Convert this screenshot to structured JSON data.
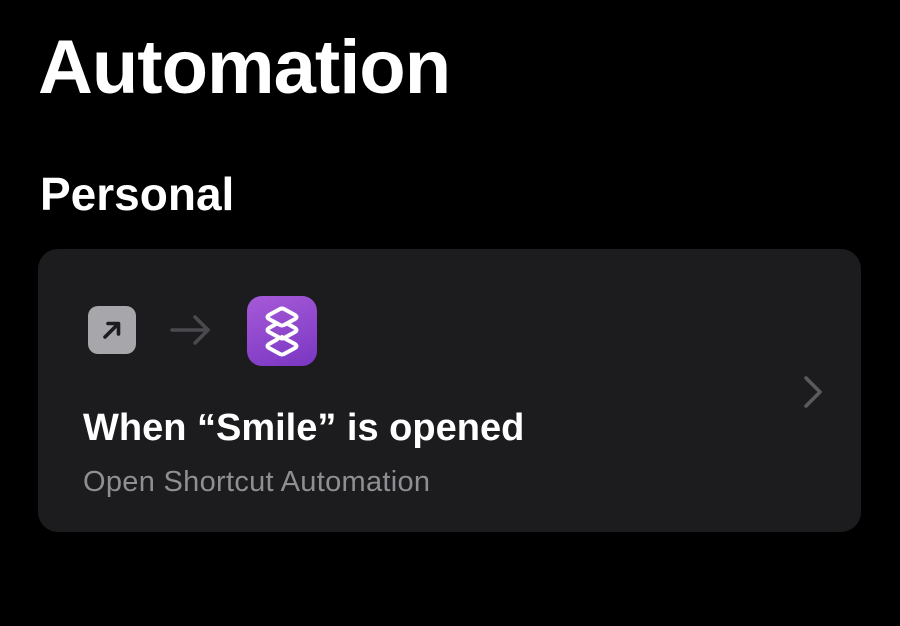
{
  "header": {
    "title": "Automation"
  },
  "sections": [
    {
      "title": "Personal",
      "automations": [
        {
          "title": "When “Smile” is opened",
          "subtitle": "Open Shortcut Automation",
          "trigger_icon": "app-opened-icon",
          "action_icon": "shortcuts-app-icon",
          "accessory_icon": "chevron-right-icon"
        }
      ]
    }
  ],
  "colors": {
    "background": "#000000",
    "card_background": "#1c1c1e",
    "primary_text": "#ffffff",
    "secondary_text": "#8e8e93",
    "trigger_icon_bg": "#a7a7ab",
    "shortcuts_icon_bg": "#9147d0",
    "chevron": "#5a5a5e"
  }
}
